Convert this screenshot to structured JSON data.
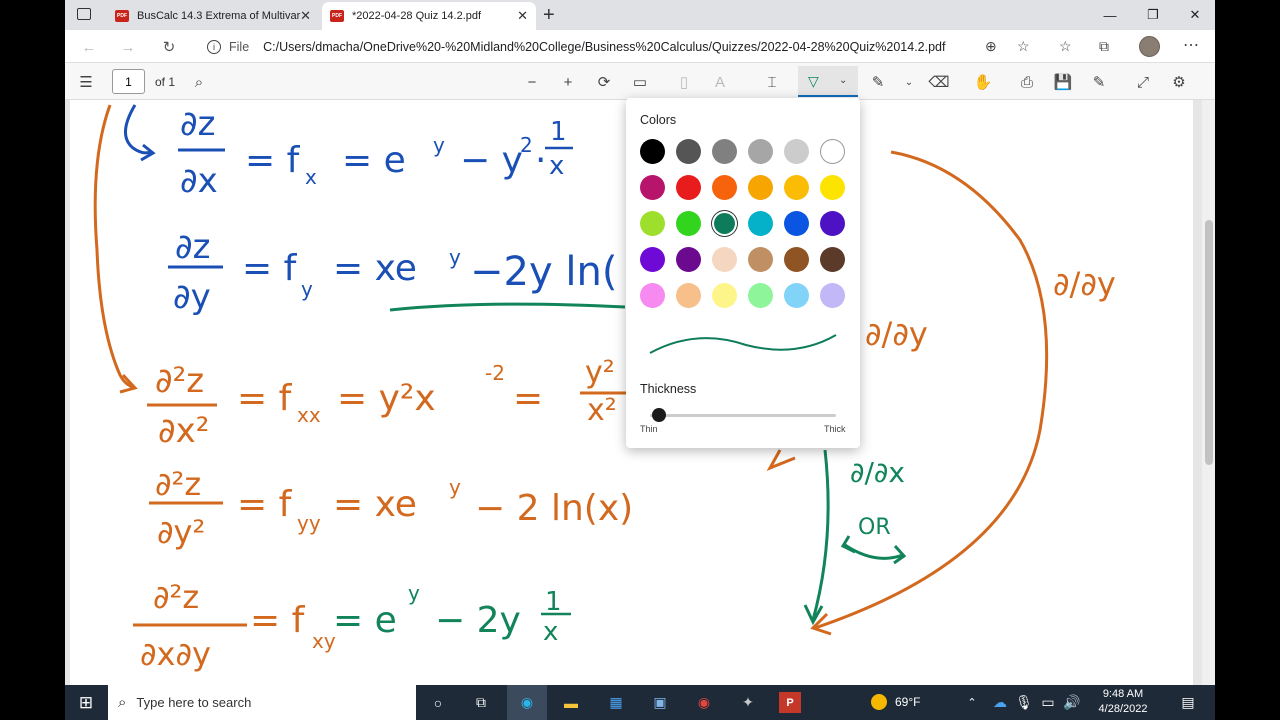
{
  "browser": {
    "tabs": [
      {
        "title": "BusCalc 14.3 Extrema of Multivar",
        "icon": "pdf-icon"
      },
      {
        "title": "*2022-04-28 Quiz 14.2.pdf",
        "icon": "pdf-icon",
        "active": true
      }
    ],
    "new_tab": "+",
    "address": {
      "info_label": "File",
      "url": "C:/Users/dmacha/OneDrive%20-%20Midland%20College/Business%20Calculus/Quizzes/2022-04-28%20Quiz%2014.2.pdf"
    }
  },
  "pdf_toolbar": {
    "page_number": "1",
    "page_count": "of 1"
  },
  "popup": {
    "colors_title": "Colors",
    "thickness_title": "Thickness",
    "thin_label": "Thin",
    "thick_label": "Thick",
    "thickness_value": 0.05,
    "selected_color": "#0e7c5a",
    "swatches": [
      "#000000",
      "#555555",
      "#808080",
      "#a6a6a6",
      "#cccccc",
      "#ffffff",
      "#b7156b",
      "#e81c1c",
      "#f7630c",
      "#f7a500",
      "#fbbc05",
      "#fde300",
      "#9edf2d",
      "#33d41d",
      "#0e7c5a",
      "#05b1c9",
      "#0a55e2",
      "#4c12c4",
      "#6f0ad6",
      "#6b0a8f",
      "#f5d6c0",
      "#c09064",
      "#8e5423",
      "#5c3a2a",
      "#f68af0",
      "#f7c08a",
      "#fdf58a",
      "#8ef59a",
      "#82d3f8",
      "#c2b7f7"
    ]
  },
  "handwriting": {
    "line1": "∂z/∂x = fx = e^y − y²·1/x",
    "line2": "∂z/∂y = fy = xe^y − 2y ln(x)",
    "line3": "∂²z/∂x² = fxx = y²x⁻² = y²/x²",
    "line4": "∂²z/∂y² = fyy = xe^y − 2 ln(x)",
    "line5": "∂²z/∂x∂y = fxy = e^y − 2y 1/x",
    "notes": [
      "∂/∂y",
      "∂/∂y",
      "∂/∂x",
      "OR"
    ],
    "colors": {
      "blue": "#1a4fb5",
      "orange": "#d2691e",
      "green": "#12845a"
    }
  },
  "taskbar": {
    "search_placeholder": "Type here to search",
    "weather": "69°F",
    "time": "9:48 AM",
    "date": "4/28/2022"
  }
}
